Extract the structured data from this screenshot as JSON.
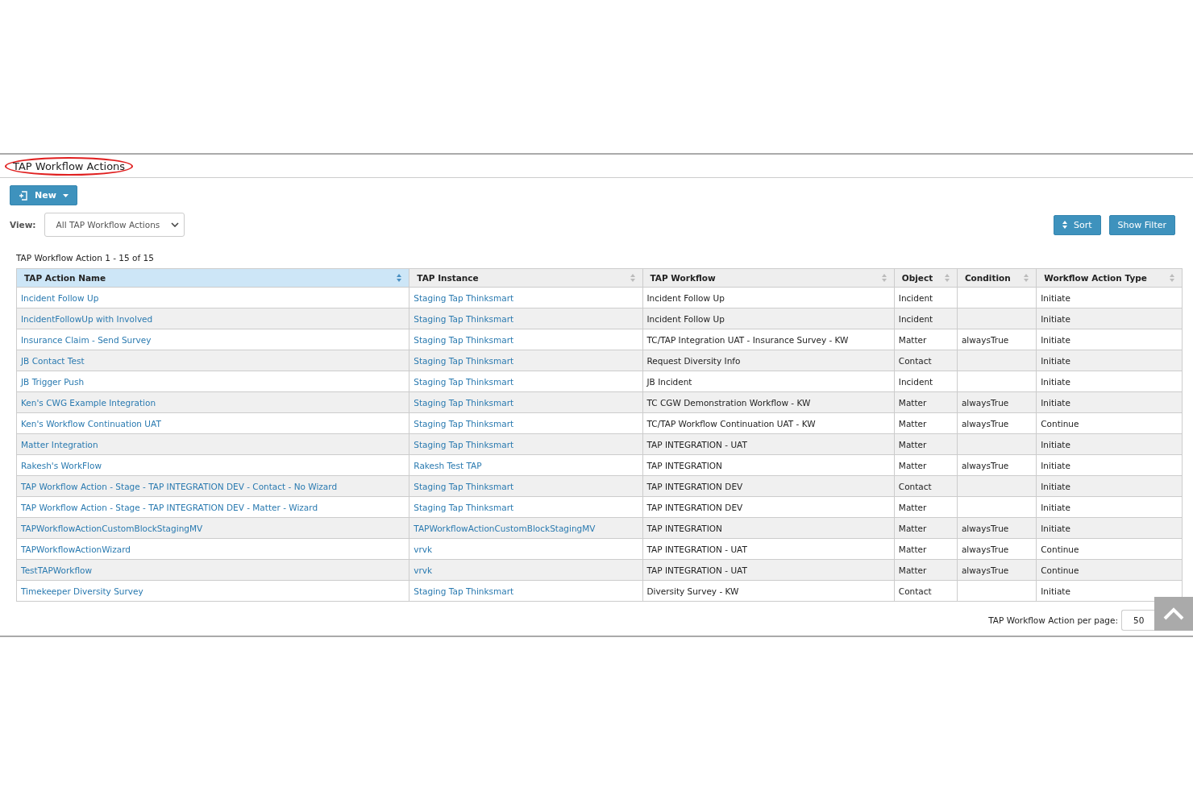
{
  "title": "TAP Workflow Actions",
  "new_button": {
    "label": "New"
  },
  "view": {
    "label": "View:",
    "value": "All TAP Workflow Actions"
  },
  "sort_button": {
    "label": "Sort"
  },
  "filter_button": {
    "label": "Show Filter"
  },
  "record_count": "TAP Workflow Action 1 - 15 of 15",
  "table": {
    "columns": [
      {
        "label": "TAP Action Name",
        "sorted": true
      },
      {
        "label": "TAP Instance",
        "sorted": false
      },
      {
        "label": "TAP Workflow",
        "sorted": false
      },
      {
        "label": "Object",
        "sorted": false
      },
      {
        "label": "Condition",
        "sorted": false
      },
      {
        "label": "Workflow Action Type",
        "sorted": false
      }
    ],
    "rows": [
      {
        "name": "Incident Follow Up",
        "instance": "Staging Tap Thinksmart",
        "workflow": "Incident Follow Up",
        "object": "Incident",
        "condition": "",
        "type": "Initiate"
      },
      {
        "name": "IncidentFollowUp with Involved",
        "instance": "Staging Tap Thinksmart",
        "workflow": "Incident Follow Up",
        "object": "Incident",
        "condition": "",
        "type": "Initiate"
      },
      {
        "name": "Insurance Claim - Send Survey",
        "instance": "Staging Tap Thinksmart",
        "workflow": "TC/TAP Integration UAT - Insurance Survey - KW",
        "object": "Matter",
        "condition": "alwaysTrue",
        "type": "Initiate"
      },
      {
        "name": "JB Contact Test",
        "instance": "Staging Tap Thinksmart",
        "workflow": "Request Diversity Info",
        "object": "Contact",
        "condition": "",
        "type": "Initiate"
      },
      {
        "name": "JB Trigger Push",
        "instance": "Staging Tap Thinksmart",
        "workflow": "JB Incident",
        "object": "Incident",
        "condition": "",
        "type": "Initiate"
      },
      {
        "name": "Ken's CWG Example Integration",
        "instance": "Staging Tap Thinksmart",
        "workflow": "TC CGW Demonstration Workflow - KW",
        "object": "Matter",
        "condition": "alwaysTrue",
        "type": "Initiate"
      },
      {
        "name": "Ken's Workflow Continuation UAT",
        "instance": "Staging Tap Thinksmart",
        "workflow": "TC/TAP Workflow Continuation UAT - KW",
        "object": "Matter",
        "condition": "alwaysTrue",
        "type": "Continue"
      },
      {
        "name": "Matter Integration",
        "instance": "Staging Tap Thinksmart",
        "workflow": "TAP INTEGRATION - UAT",
        "object": "Matter",
        "condition": "",
        "type": "Initiate"
      },
      {
        "name": "Rakesh's WorkFlow",
        "instance": "Rakesh Test TAP",
        "workflow": "TAP INTEGRATION",
        "object": "Matter",
        "condition": "alwaysTrue",
        "type": "Initiate"
      },
      {
        "name": "TAP Workflow Action - Stage - TAP INTEGRATION DEV - Contact - No Wizard",
        "instance": "Staging Tap Thinksmart",
        "workflow": "TAP INTEGRATION DEV",
        "object": "Contact",
        "condition": "",
        "type": "Initiate"
      },
      {
        "name": "TAP Workflow Action - Stage - TAP INTEGRATION DEV - Matter - Wizard",
        "instance": "Staging Tap Thinksmart",
        "workflow": "TAP INTEGRATION DEV",
        "object": "Matter",
        "condition": "",
        "type": "Initiate"
      },
      {
        "name": "TAPWorkflowActionCustomBlockStagingMV",
        "instance": "TAPWorkflowActionCustomBlockStagingMV",
        "workflow": "TAP INTEGRATION",
        "object": "Matter",
        "condition": "alwaysTrue",
        "type": "Initiate"
      },
      {
        "name": "TAPWorkflowActionWizard",
        "instance": "vrvk",
        "workflow": "TAP INTEGRATION - UAT",
        "object": "Matter",
        "condition": "alwaysTrue",
        "type": "Continue"
      },
      {
        "name": "TestTAPWorkflow",
        "instance": "vrvk",
        "workflow": "TAP INTEGRATION - UAT",
        "object": "Matter",
        "condition": "alwaysTrue",
        "type": "Continue"
      },
      {
        "name": "Timekeeper Diversity Survey",
        "instance": "Staging Tap Thinksmart",
        "workflow": "Diversity Survey - KW",
        "object": "Contact",
        "condition": "",
        "type": "Initiate"
      }
    ]
  },
  "per_page": {
    "label": "TAP Workflow Action per page:",
    "value": "50"
  }
}
